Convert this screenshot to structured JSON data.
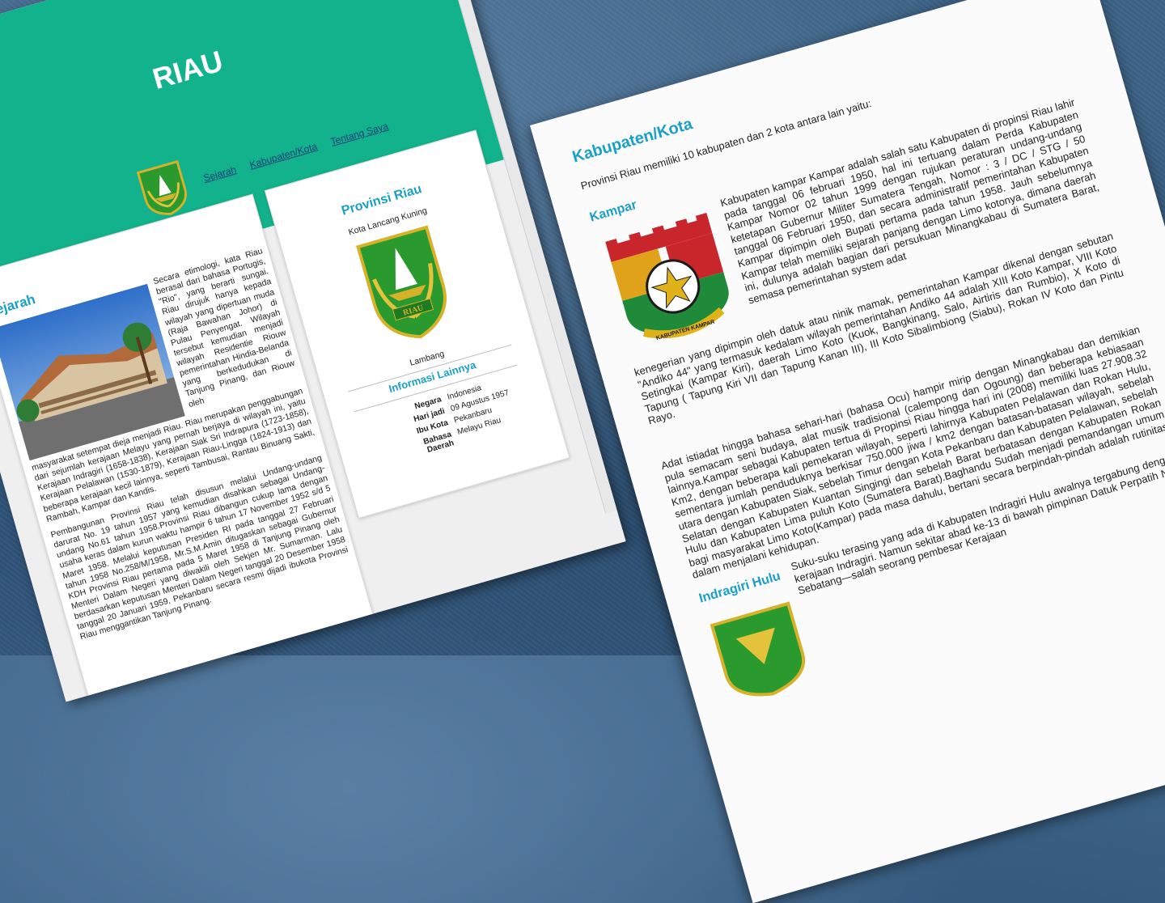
{
  "site": {
    "title": "RIAU",
    "nav": [
      {
        "label": "Sejarah"
      },
      {
        "label": "Kabupaten/Kota"
      },
      {
        "label": "Tentang Saya"
      }
    ]
  },
  "sejarah": {
    "title": "Sejarah",
    "p1": "Secara etimologi, kata Riau berasal dari bahasa Portugis, \"Rio\", yang berarti sungai. Riau dirujuk hanya kepada wilayah yang dipertuan muda (Raja Bawahan Johor) di Pulau Penyengat. Wilayah tersebut kemudian menjadi wilayah Residentie Riouw pemerintahan Hindia-Belanda yang berkedudukan di Tanjung Pinang, dan Riouw oleh",
    "p2": "masyarakat setempat dieja menjadi Riau. Riau merupakan penggabungan dari sejumlah kerajaan Melayu yang pernah berjaya di wilayah ini, yaitu Kerajaan Indragiri (1658-1838), Kerajaan Siak Sri Indrapura (1723-1858), Kerajaan Pelalawan (1530-1879), Kerajaan Riau-Lingga (1824-1913) dan beberapa kerajaan kecil lainnya, seperti Tambusai, Rantau Binuang Sakti, Rambah, Kampar dan Kandis.",
    "p3": "Pembangunan Provinsi Riau telah disusun melalui Undang-undang darurat No. 19 tahun 1957 yang kemudian disahkan sebagai Undang-undang No.61 tahun 1958.Provinsi Riau dibangun cukup lama dengan usaha keras dalam kurun waktu hampir 6 tahun 17 November 1952 s/d 5 Maret 1958. Melalui keputusan Presiden RI pada tanggal 27 Februari tahun 1958 No.258/M/1958, Mr.S.M.Amin ditugaskan sebagai Gubernur KDH Provinsi Riau pertama pada 5 Maret 1958 di Tanjung Pinang oleh Menteri Dalam Negeri yang diwakili oleh Sekjen Mr. Sumarman. Lalu berdasarkan keputusan Menteri Dalam Negeri tanggal 20 Desember 1958 tanggal 20 Januari 1959, Pekanbaru secara resmi dijadi ibukota Provinsi Riau menggantikan Tanjung Pinang."
  },
  "provinsi": {
    "title": "Provinsi Riau",
    "subtitle": "Kota Lancang Kuning",
    "emblem_label": "Lambang",
    "emblem_text": "RIAU",
    "info_title": "Informasi Lainnya",
    "info": [
      {
        "key": "Negara",
        "value": "Indonesia"
      },
      {
        "key": "Hari jadi",
        "value": "09 Agustus 1957"
      },
      {
        "key": "Ibu Kota",
        "value": "Pekanbaru"
      },
      {
        "key": "Bahasa Daerah",
        "value": "Melayu Riau"
      }
    ]
  },
  "kabupaten": {
    "title": "Kabupaten/Kota",
    "intro": "Provinsi Riau memiliki 10 kabupaten dan 2 kota antara lain yaitu:",
    "kampar": {
      "title": "Kampar",
      "logo_text": "KABUPATEN KAMPAR",
      "p1": "Kabupaten kampar Kampar adalah salah satu Kabupaten di propinsi Riau lahir pada tanggal 06 februari 1950, hal ini tertuang dalam Perda Kabupaten Kampar Nomor 02 tahun 1999 dengan rujukan peraturan undang-undang ketetapan Gubernur Militer Sumatera Tengah, Nomor : 3 / DC / STG / 50 tanggal 06 Februari 1950, dan secara administratif pemerintahan Kabupaten Kampar dipimpin oleh Bupati pertama pada tahun 1958. Jauh sebelumnya Kampar telah memiliki sejarah panjang dengan Limo kotonya, dimana daerah ini, dulunya adalah bagian dari persukuan Minangkabau di Sumatera Barat, semasa pemerintahan system adat",
      "p2": "kenegerian yang dipimpin oleh datuk atau ninik mamak, pemerintahan Kampar dikenal dengan sebutan \"Andiko 44\" yang termasuk kedalam wilayah pemerintahan Andiko 44 adalah XIII Koto Kampar, VIII Koto Setingkai (Kampar Kiri), daerah Limo Koto (Kuok, Bangkinang, Salo, Airtiris dan Rumbio), X Koto di Tapung ( Tapung Kiri VII dan Tapung Kanan III), III Koto Sibalimbiong (Siabu), Rokan IV Koto dan Pintu Rayo.",
      "p3": "Adat istiadat hingga bahasa sehari-hari (bahasa Ocu) hampir mirip dengan Minangkabau dan demikian pula semacam seni budaya, alat musik tradisional (calempong dan Ogoung) dan beberapa kebiasaan lainnya.Kampar sebagai Kabupaten tertua di Propinsi Riau hingga hari ini (2008) memiliki luas 27.908.32 Km2, dengan beberapa kali pemekaran wilayah, seperti lahirnya Kabupaten Pelalawan dan Rokan Hulu, sementara jumlah penduduknya berkisar 750.000 jiwa / km2 dengan batasan-batasan wilayah, sebelah utara dengan Kabupaten Siak, sebelah Timur dengan Kota Pekanbaru dan Kabupaten Pelalawan, sebelah Selatan dengan Kabupaten Kuantan Singingi dan sebelah Barat berbatasan dengan Kabupaten Rokan Hulu dan Kabupaten Lima puluh Koto (Sumatera Barat).Baghandu Sudah menjadi pemandangan umum bagi masyarakat Limo Koto(Kampar) pada masa dahulu, bertani secara berpindah-pindah adalah rutinitas dalam menjalani kehidupan."
    },
    "indragiri": {
      "title": "Indragiri Hulu",
      "p1": "Suku-suku terasing yang ada di Kabupaten Indragiri Hulu awalnya tergabung dengan kerajaan Indragiri. Namun sekitar abad ke-13 di bawah pimpinan Datuk Perpatih Nan Sebatang—salah seorang pembesar Kerajaan"
    }
  },
  "colors": {
    "header_green": "#12b38c",
    "heading_blue": "#1aa0c7",
    "link_blue": "#1a3d7c"
  }
}
